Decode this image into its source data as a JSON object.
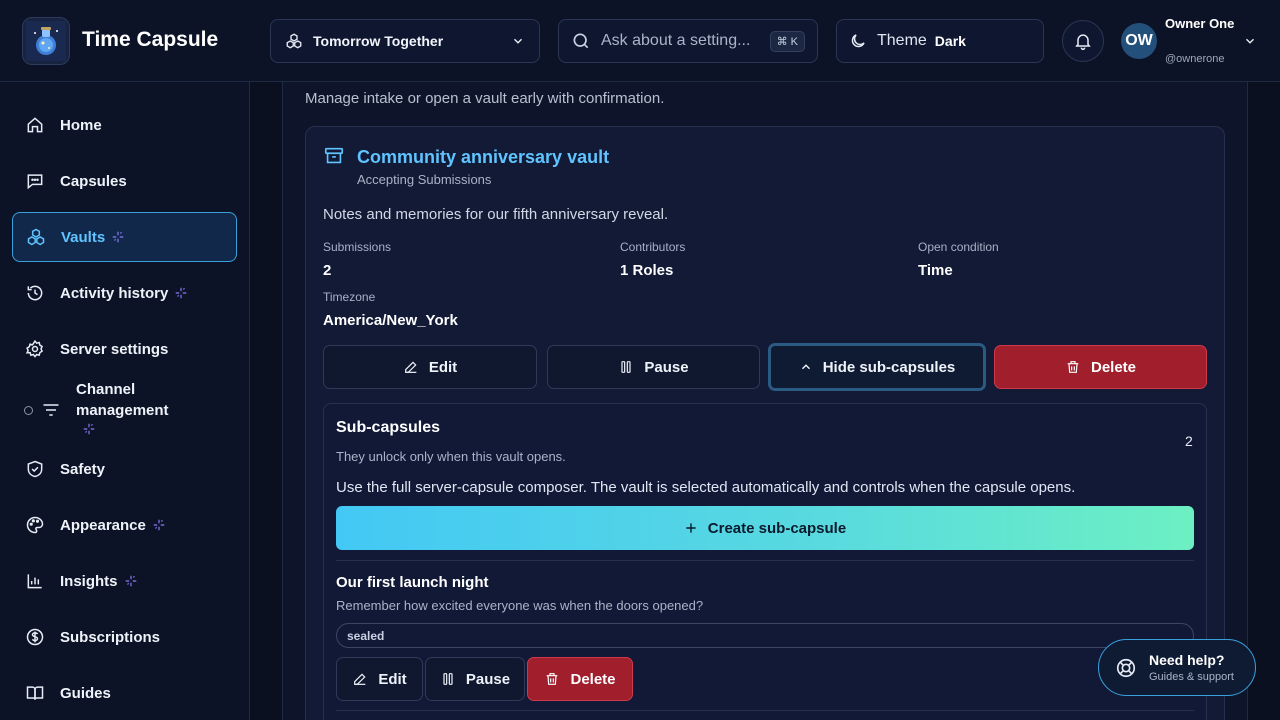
{
  "header": {
    "app_title": "Time Capsule",
    "server_name": "Tomorrow Together",
    "search_placeholder": "Ask about a setting...",
    "search_shortcut": "⌘ K",
    "theme_label": "Theme",
    "theme_value": "Dark",
    "user": {
      "initials": "OW",
      "name": "Owner One",
      "handle": "@ownerone"
    }
  },
  "sidebar": {
    "items": [
      {
        "label": "Home",
        "icon": "home-icon"
      },
      {
        "label": "Capsules",
        "icon": "message-square-icon"
      },
      {
        "label": "Vaults",
        "icon": "boxes-icon",
        "active": true,
        "spark": true
      },
      {
        "label": "Activity history",
        "icon": "history-icon",
        "spark": true
      },
      {
        "label": "Server settings",
        "icon": "gear-icon"
      },
      {
        "label": "Channel management",
        "icon": "filter-lines-icon",
        "spark": true
      },
      {
        "label": "Safety",
        "icon": "shield-check-icon"
      },
      {
        "label": "Appearance",
        "icon": "palette-icon",
        "spark": true
      },
      {
        "label": "Insights",
        "icon": "bar-chart-icon",
        "spark": true
      },
      {
        "label": "Subscriptions",
        "icon": "dollar-circle-icon"
      },
      {
        "label": "Guides",
        "icon": "book-open-icon"
      }
    ]
  },
  "main": {
    "subtitle": "Manage intake or open a vault early with confirmation.",
    "vault": {
      "title": "Community anniversary vault",
      "status": "Accepting Submissions",
      "description": "Notes and memories for our fifth anniversary reveal.",
      "stats": {
        "submissions_label": "Submissions",
        "submissions_value": "2",
        "contributors_label": "Contributors",
        "contributors_value": "1 Roles",
        "open_condition_label": "Open condition",
        "open_condition_value": "Time",
        "timezone_label": "Timezone",
        "timezone_value": "America/New_York"
      },
      "actions": {
        "edit": "Edit",
        "pause": "Pause",
        "hide_sub": "Hide sub-capsules",
        "delete": "Delete"
      }
    },
    "sub_capsules": {
      "title": "Sub-capsules",
      "count": "2",
      "description": "They unlock only when this vault opens.",
      "help_text": "Use the full server-capsule composer. The vault is selected automatically and controls when the capsule opens.",
      "create_label": "Create sub-capsule",
      "items": [
        {
          "title": "Our first launch night",
          "description": "Remember how excited everyone was when the doors opened?",
          "status": "sealed",
          "actions": {
            "edit": "Edit",
            "pause": "Pause",
            "delete": "Delete"
          }
        }
      ]
    }
  },
  "help": {
    "title": "Need help?",
    "subtitle": "Guides & support"
  },
  "colors": {
    "accent": "#5fc4ff",
    "danger": "#a11e2c",
    "spark": "#8b7cf6",
    "background": "#0b1020"
  }
}
